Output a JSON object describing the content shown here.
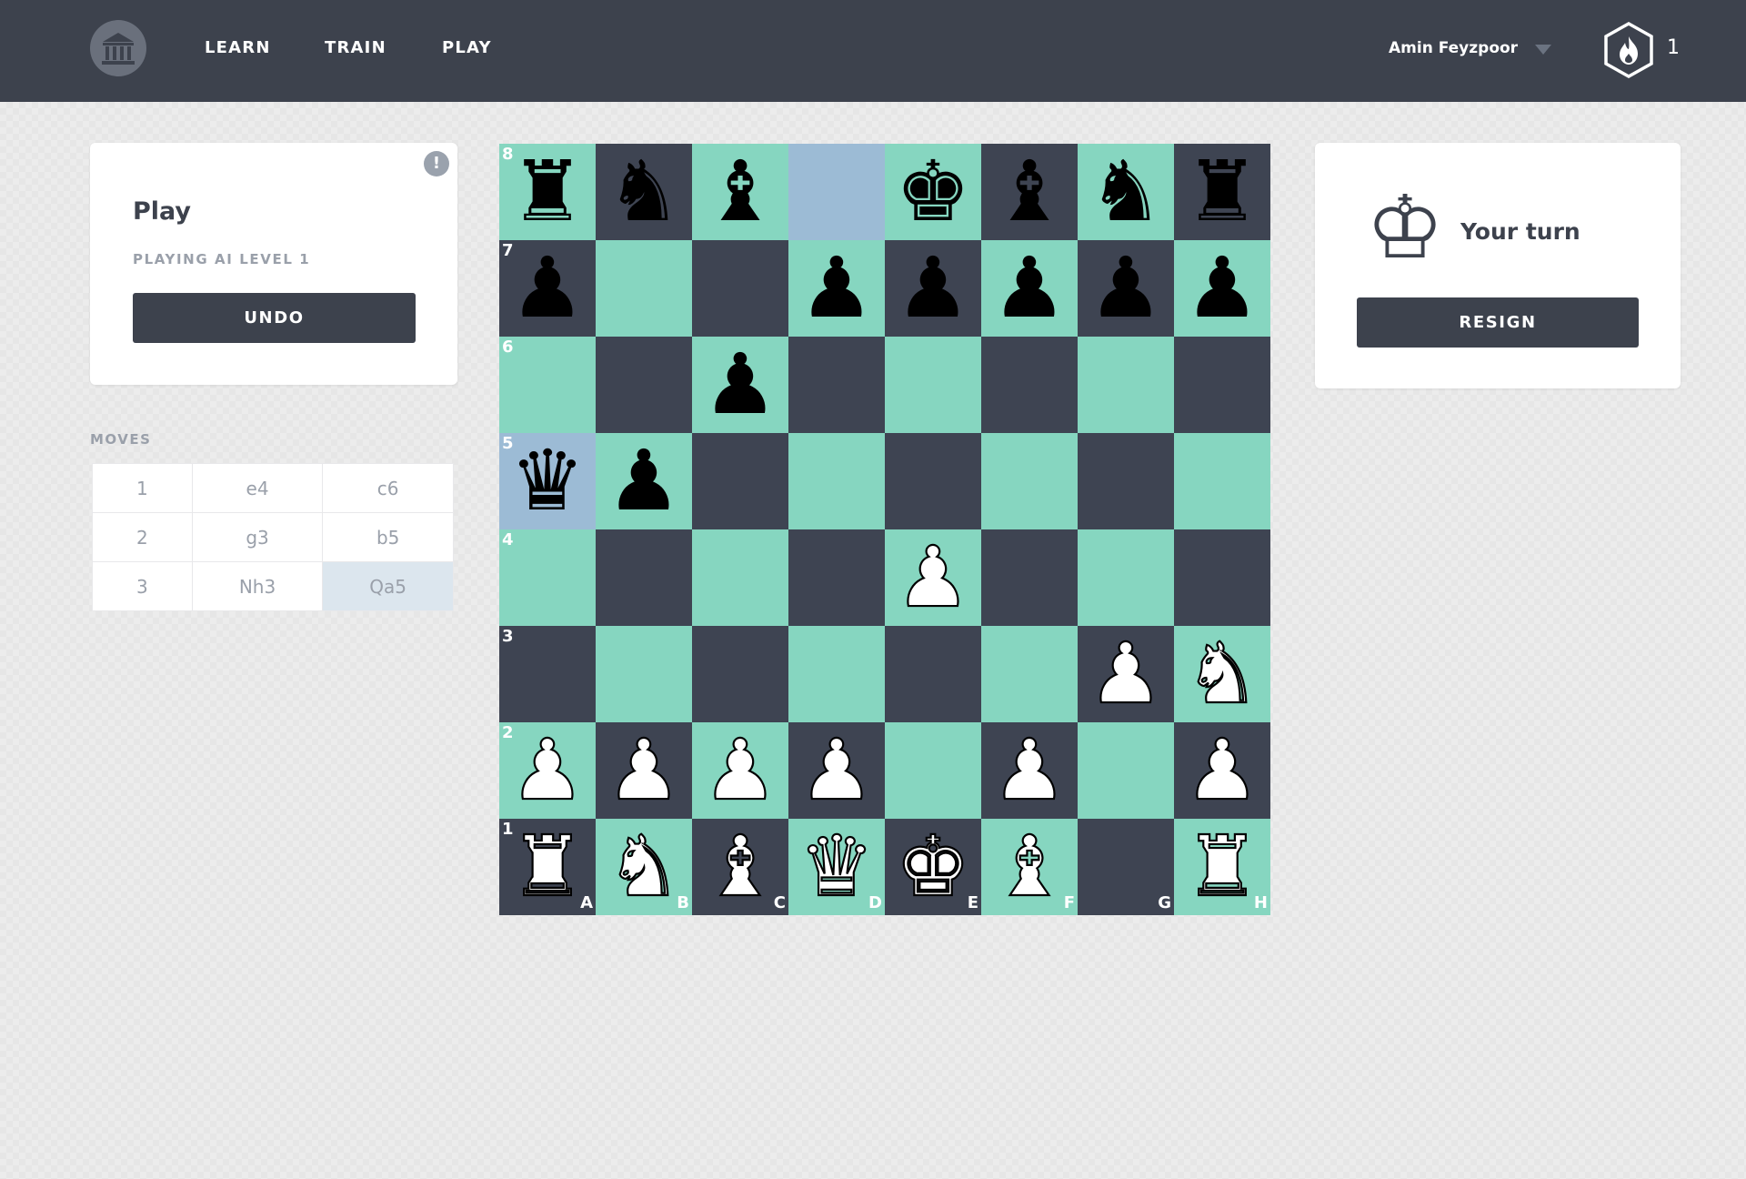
{
  "header": {
    "nav": [
      {
        "label": "LEARN"
      },
      {
        "label": "TRAIN"
      },
      {
        "label": "PLAY"
      }
    ],
    "user_name": "Amin Feyzpoor",
    "streak_count": "1"
  },
  "play_card": {
    "title": "Play",
    "subtitle": "PLAYING AI LEVEL 1",
    "undo_label": "UNDO",
    "info_glyph": "!"
  },
  "moves": {
    "label": "MOVES",
    "rows": [
      {
        "num": "1",
        "white": "e4",
        "black": "c6"
      },
      {
        "num": "2",
        "white": "g3",
        "black": "b5"
      },
      {
        "num": "3",
        "white": "Nh3",
        "black": "Qa5"
      }
    ],
    "active_move": "Qa5"
  },
  "board": {
    "ranks": [
      "8",
      "7",
      "6",
      "5",
      "4",
      "3",
      "2",
      "1"
    ],
    "files": [
      "A",
      "B",
      "C",
      "D",
      "E",
      "F",
      "G",
      "H"
    ],
    "highlight_squares": [
      "d8",
      "a5"
    ],
    "position": [
      [
        "r",
        "n",
        "b",
        "",
        "k",
        "b",
        "n",
        "r"
      ],
      [
        "p",
        "",
        "",
        "p",
        "p",
        "p",
        "p",
        "p"
      ],
      [
        "",
        "",
        "p",
        "",
        "",
        "",
        "",
        ""
      ],
      [
        "q",
        "p",
        "",
        "",
        "",
        "",
        "",
        ""
      ],
      [
        "",
        "",
        "",
        "",
        "P",
        "",
        "",
        ""
      ],
      [
        "",
        "",
        "",
        "",
        "",
        "",
        "P",
        "N"
      ],
      [
        "P",
        "P",
        "P",
        "P",
        "",
        "P",
        "",
        "P"
      ],
      [
        "R",
        "N",
        "B",
        "Q",
        "K",
        "B",
        "",
        "R"
      ]
    ],
    "colors": {
      "light": "#86d6c0",
      "dark": "#3e4452",
      "highlight": "#9cbbd5"
    }
  },
  "turn_card": {
    "turn_text": "Your turn",
    "resign_label": "RESIGN"
  },
  "icons": {
    "logo": "building-icon",
    "caret": "chevron-down-icon",
    "streak": "flame-hexagon-icon",
    "info": "info-icon",
    "turn": "king-icon"
  }
}
